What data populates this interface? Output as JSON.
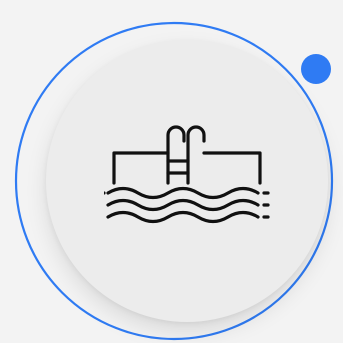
{
  "badge": {
    "icon": "swimming-pool-ladder-icon",
    "ring_color": "#2f7bf3",
    "dot_color": "#2f7bf3",
    "disc_color": "#ececec",
    "icon_color": "#111111",
    "background_color": "#f3f3f3"
  }
}
